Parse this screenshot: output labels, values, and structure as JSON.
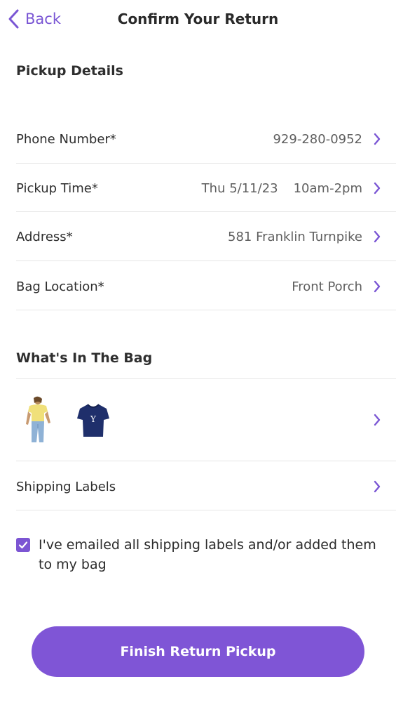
{
  "header": {
    "back_label": "Back",
    "title": "Confirm Your Return"
  },
  "pickup": {
    "section_title": "Pickup Details",
    "rows": [
      {
        "label": "Phone Number*",
        "value": "929-280-0952"
      },
      {
        "label": "Pickup Time*",
        "date": "Thu 5/11/23",
        "window": "10am-2pm"
      },
      {
        "label": "Address*",
        "value": "581 Franklin Turnpike"
      },
      {
        "label": "Bag Location*",
        "value": "Front Porch"
      }
    ]
  },
  "bag": {
    "section_title": "What's In The Bag",
    "items": [
      {
        "icon": "woman-yellow-top-jeans-product-image"
      },
      {
        "icon": "navy-tshirt-product-image"
      }
    ]
  },
  "shipping": {
    "label": "Shipping Labels"
  },
  "confirmation": {
    "checked": true,
    "text": "I've emailed all shipping labels and/or added them to my bag"
  },
  "cta": {
    "label": "Finish Return Pickup"
  },
  "colors": {
    "accent": "#7f55d6",
    "text": "#2b2b2b",
    "muted": "#5f5f5f",
    "divider": "#e6e6e6"
  }
}
